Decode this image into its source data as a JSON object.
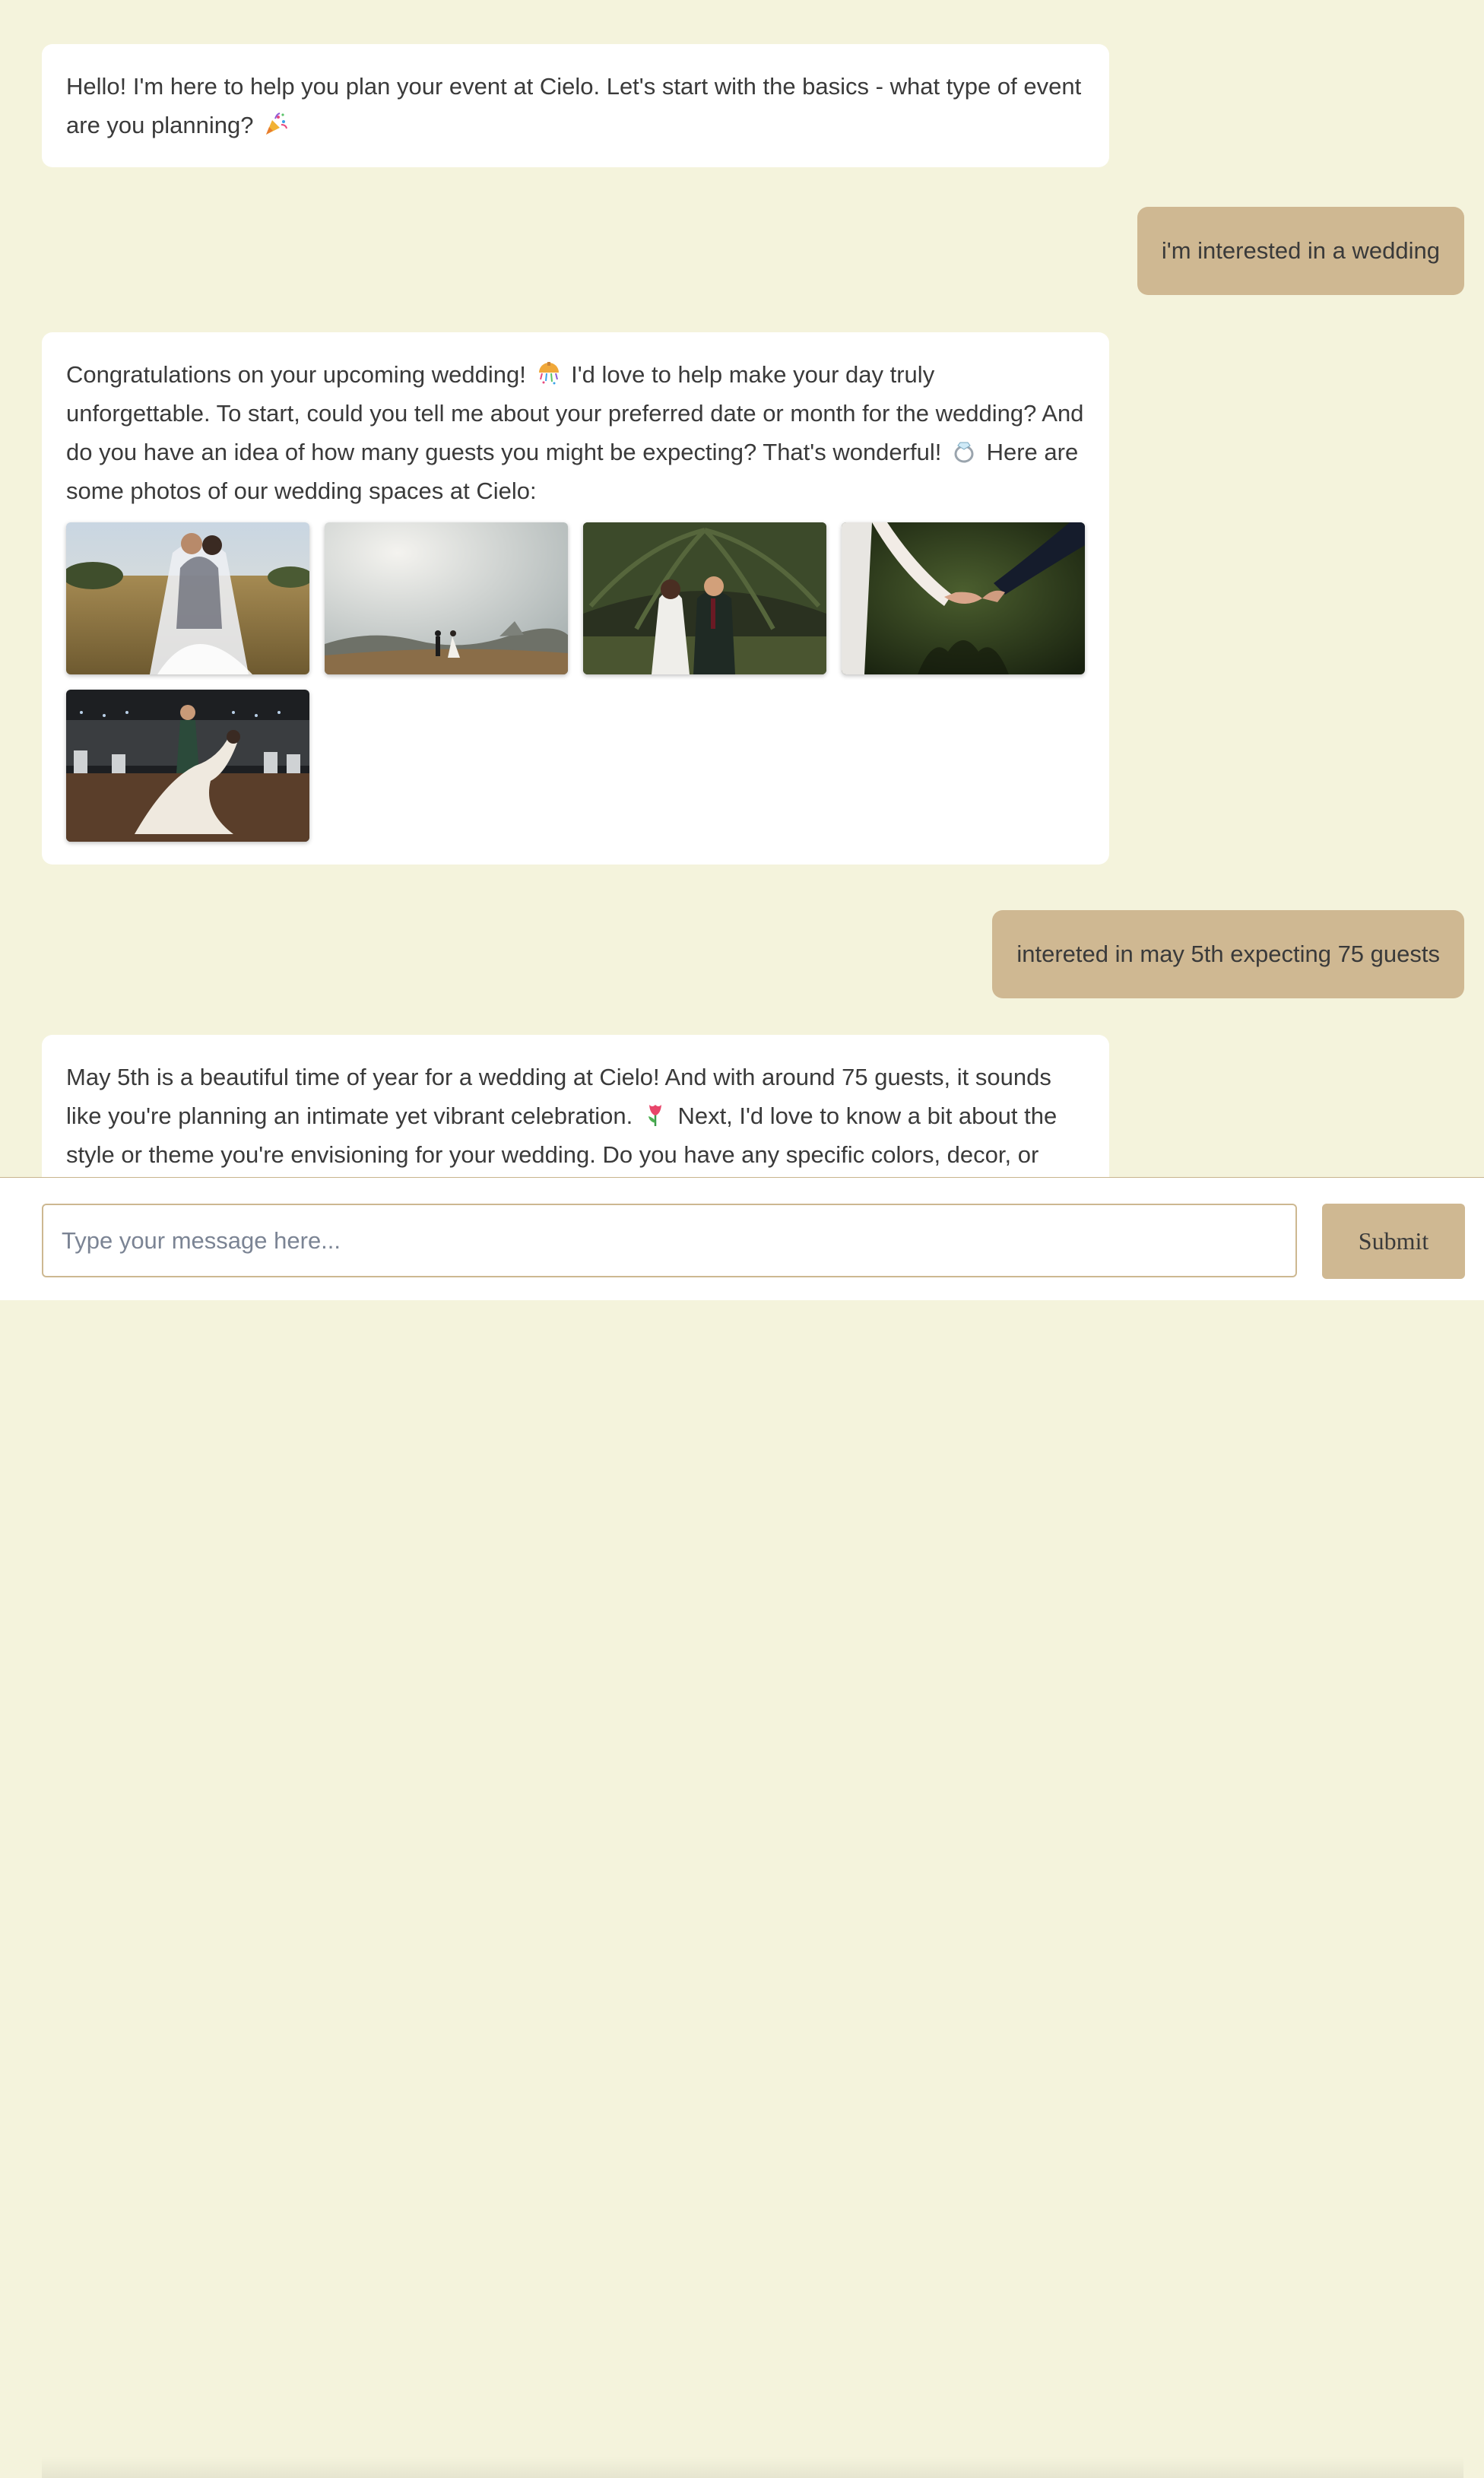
{
  "messages": [
    {
      "role": "assistant",
      "text_before": "Hello! I'm here to help you plan your event at Cielo. Let's start with the basics - what type of event are you planning?",
      "emoji": "party-popper-icon"
    },
    {
      "role": "user",
      "text": "i'm interested in a wedding"
    },
    {
      "role": "assistant",
      "part1": "Congratulations on your upcoming wedding!",
      "emoji1": "confetti-ball-icon",
      "part2": "I'd love to help make your day truly unforgettable. To start, could you tell me about your preferred date or month for the wedding? And do you have an idea of how many guests you might be expecting? That's wonderful!",
      "emoji2": "ring-icon",
      "part3": "Here are some photos of our wedding spaces at Cielo:",
      "photos": [
        "couple-in-field-photo",
        "couple-walking-landscape-photo",
        "couple-under-palm-photo",
        "holding-hands-photo",
        "couple-dancing-reception-photo"
      ]
    },
    {
      "role": "user",
      "text": "intereted in may 5th expecting 75 guests"
    },
    {
      "role": "assistant",
      "part1": "May 5th is a beautiful time of year for a wedding at Cielo! And with around 75 guests, it sounds like you're planning an intimate yet vibrant celebration.",
      "emoji1": "tulip-icon",
      "part2": "Next, I'd love to know a bit about the style or theme you're envisioning for your wedding. Do you have any specific colors, decor, or"
    }
  ],
  "input": {
    "placeholder": "Type your message here...",
    "value": ""
  },
  "submit_label": "Submit",
  "colors": {
    "background": "#f4f3dc",
    "assistant_bubble": "#ffffff",
    "user_bubble": "#cfb892",
    "text": "#3a3a3a"
  }
}
